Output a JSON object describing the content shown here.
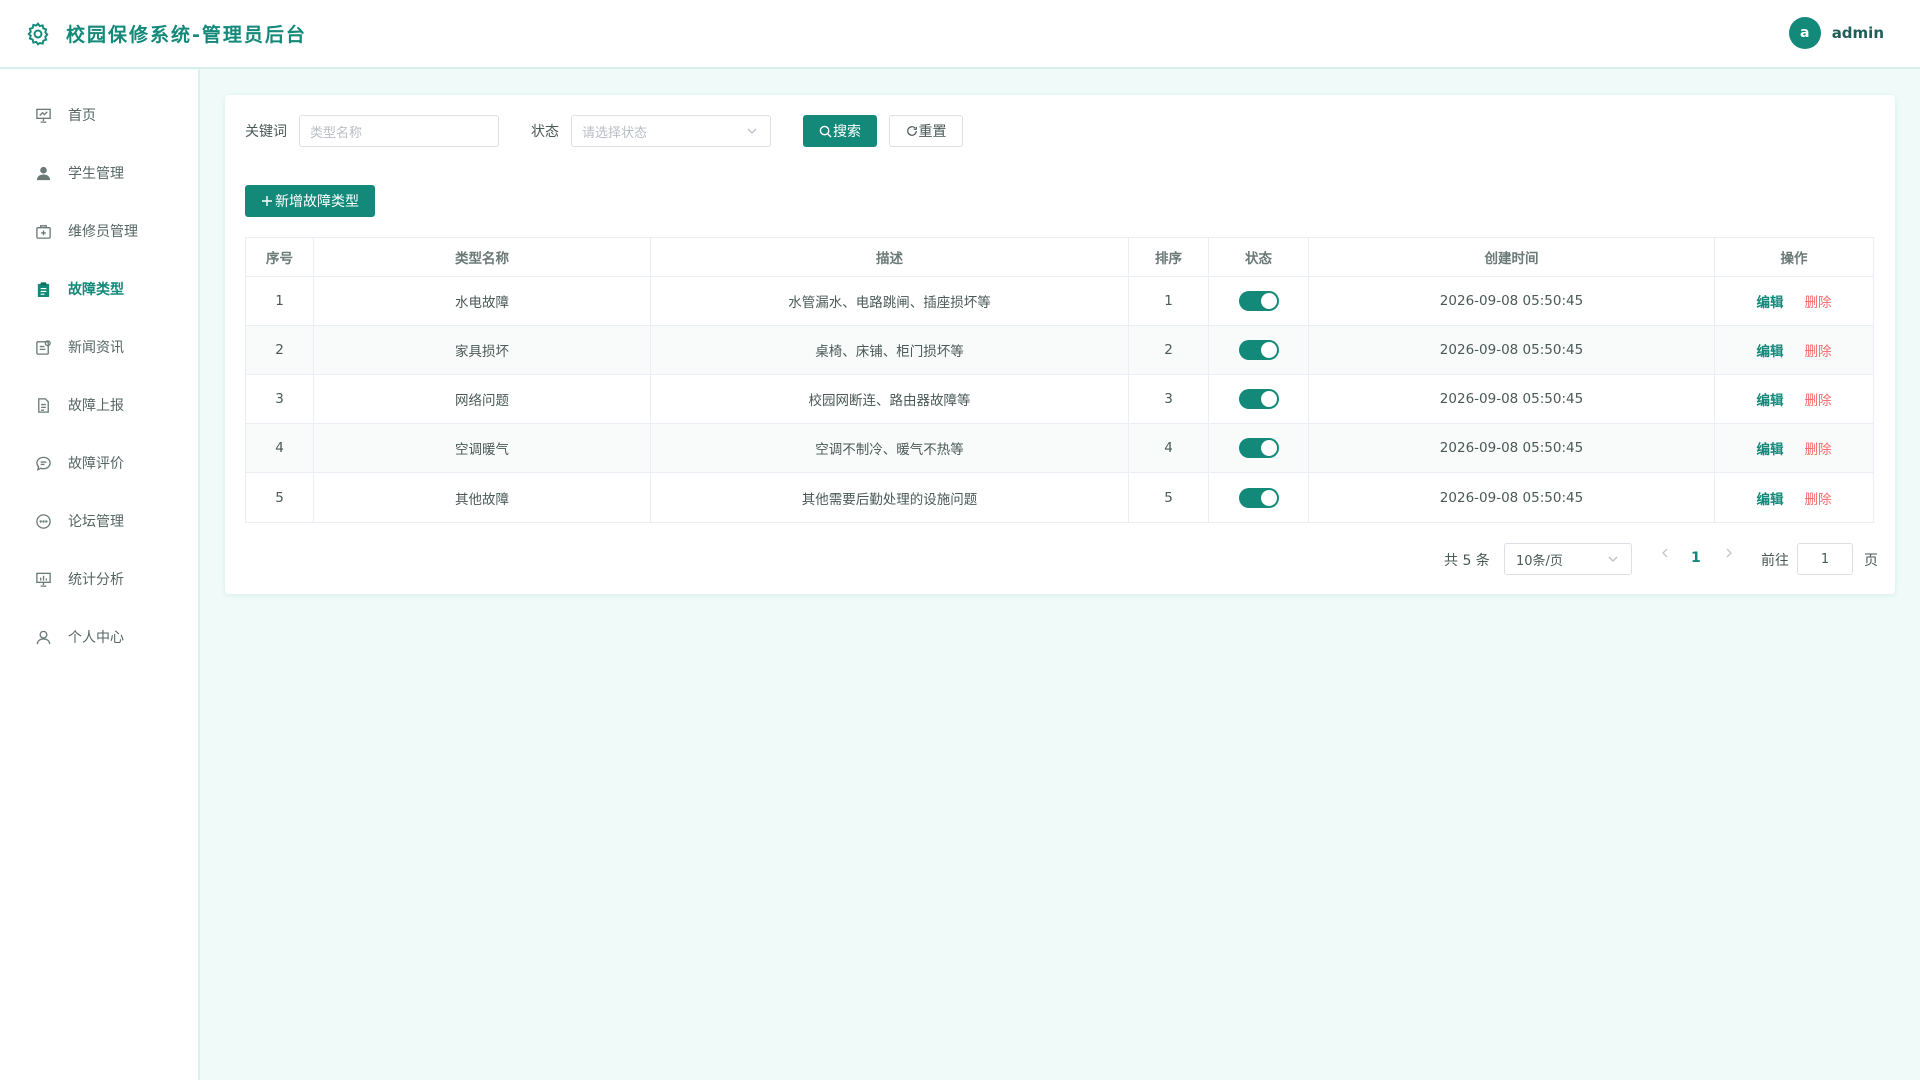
{
  "header": {
    "title": "校园保修系统-管理员后台",
    "avatar_letter": "a",
    "username": "admin",
    "accent_color": "#13897a"
  },
  "sidebar": {
    "items": [
      {
        "label": "首页",
        "icon": "presentation-board-icon"
      },
      {
        "label": "学生管理",
        "icon": "user-icon"
      },
      {
        "label": "维修员管理",
        "icon": "toolbox-icon"
      },
      {
        "label": "故障类型",
        "icon": "clipboard-icon",
        "active": true
      },
      {
        "label": "新闻资讯",
        "icon": "news-icon"
      },
      {
        "label": "故障上报",
        "icon": "document-icon"
      },
      {
        "label": "故障评价",
        "icon": "comment-icon"
      },
      {
        "label": "论坛管理",
        "icon": "chat-icon"
      },
      {
        "label": "统计分析",
        "icon": "stats-board-icon"
      },
      {
        "label": "个人中心",
        "icon": "person-outline-icon"
      }
    ]
  },
  "filters": {
    "keyword_label": "关键词",
    "keyword_placeholder": "类型名称",
    "status_label": "状态",
    "status_placeholder": "请选择状态",
    "search_label": "搜索",
    "reset_label": "重置"
  },
  "add_button_label": "新增故障类型",
  "table": {
    "columns": [
      "序号",
      "类型名称",
      "描述",
      "排序",
      "状态",
      "创建时间",
      "操作"
    ],
    "rows": [
      {
        "index": "1",
        "name": "水电故障",
        "desc": "水管漏水、电路跳闸、插座损坏等",
        "sort": "1",
        "enabled": true,
        "created": "2026-09-08 05:50:45"
      },
      {
        "index": "2",
        "name": "家具损坏",
        "desc": "桌椅、床铺、柜门损坏等",
        "sort": "2",
        "enabled": true,
        "created": "2026-09-08 05:50:45"
      },
      {
        "index": "3",
        "name": "网络问题",
        "desc": "校园网断连、路由器故障等",
        "sort": "3",
        "enabled": true,
        "created": "2026-09-08 05:50:45"
      },
      {
        "index": "4",
        "name": "空调暖气",
        "desc": "空调不制冷、暖气不热等",
        "sort": "4",
        "enabled": true,
        "created": "2026-09-08 05:50:45"
      },
      {
        "index": "5",
        "name": "其他故障",
        "desc": "其他需要后勤处理的设施问题",
        "sort": "5",
        "enabled": true,
        "created": "2026-09-08 05:50:45"
      }
    ],
    "edit_label": "编辑",
    "delete_label": "删除"
  },
  "pagination": {
    "total_text": "共 5 条",
    "page_size": "10条/页",
    "current_page": "1",
    "goto_label": "前往",
    "goto_value": "1",
    "page_suffix": "页"
  }
}
